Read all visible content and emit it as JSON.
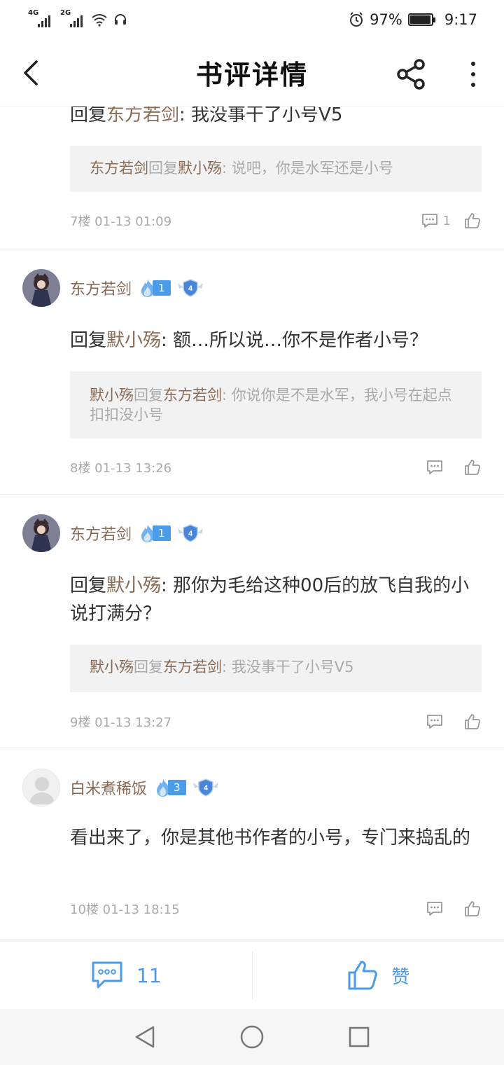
{
  "status_bar": {
    "net1": "4G",
    "net2": "2G",
    "battery_pct": "97%",
    "battery_level": 0.97,
    "time": "9:17"
  },
  "header": {
    "title": "书评详情",
    "back_icon": "back-chevron-icon",
    "share_icon": "share-icon",
    "more_icon": "more-vertical-icon"
  },
  "comments": [
    {
      "reply_prefix": "回复",
      "reply_to": "东方若剑",
      "text": ": 我没事干了小号V5",
      "quote": {
        "from": "东方若剑",
        "mid": "回复",
        "to": "默小殇",
        "text": ": 说吧，你是水军还是小号"
      },
      "floor_time": "7楼 01-13 01:09",
      "reply_count": "1"
    },
    {
      "username": "东方若剑",
      "fans_level": "1",
      "user_level": "4",
      "reply_prefix": "回复",
      "reply_to": "默小殇",
      "text": ": 额…所以说…你不是作者小号？",
      "quote": {
        "from": "默小殇",
        "mid": "回复",
        "to": "东方若剑",
        "text": ": 你说你是不是水军，我小号在起点扣扣没小号"
      },
      "floor_time": "8楼 01-13 13:26"
    },
    {
      "username": "东方若剑",
      "fans_level": "1",
      "user_level": "4",
      "reply_prefix": "回复",
      "reply_to": "默小殇",
      "text": ": 那你为毛给这种00后的放飞自我的小说打满分？",
      "quote": {
        "from": "默小殇",
        "mid": "回复",
        "to": "东方若剑",
        "text": ": 我没事干了小号V5"
      },
      "floor_time": "9楼 01-13 13:27"
    },
    {
      "username": "白米煮稀饭",
      "fans_level": "3",
      "user_level": "4",
      "text": "看出来了，你是其他书作者的小号，专门来捣乱的",
      "floor_time": "10楼 01-13 18:15"
    }
  ],
  "bottom_bar": {
    "comment_count": "11",
    "like_label": "赞"
  },
  "colors": {
    "accent": "#4a9be8",
    "username": "#8a6a54",
    "quote_bg": "#f2f2f2"
  }
}
